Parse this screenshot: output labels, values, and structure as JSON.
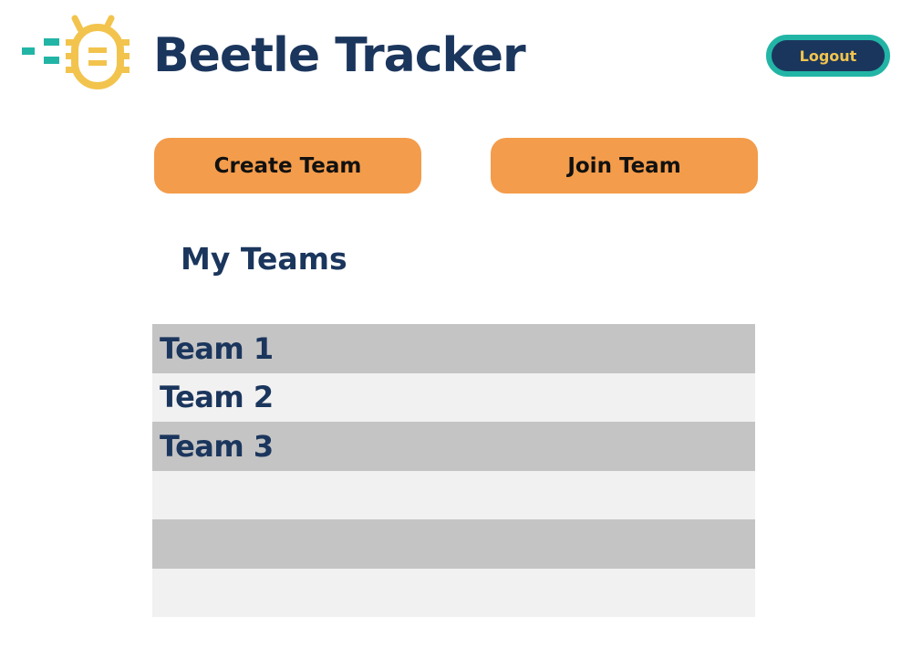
{
  "header": {
    "app_title": "Beetle Tracker",
    "logo_icon": "beetle-icon",
    "logout_label": "Logout"
  },
  "actions": {
    "create_team_label": "Create Team",
    "join_team_label": "Join Team"
  },
  "teams": {
    "section_title": "My Teams",
    "rows": [
      {
        "name": "Team 1"
      },
      {
        "name": "Team 2"
      },
      {
        "name": "Team 3"
      },
      {
        "name": ""
      },
      {
        "name": ""
      },
      {
        "name": ""
      }
    ]
  },
  "colors": {
    "navy": "#1b365d",
    "teal": "#22b5a6",
    "gold": "#f2c44e",
    "orange": "#f39c4b",
    "row_dark": "#c4c4c4",
    "row_light": "#f1f1f1"
  }
}
